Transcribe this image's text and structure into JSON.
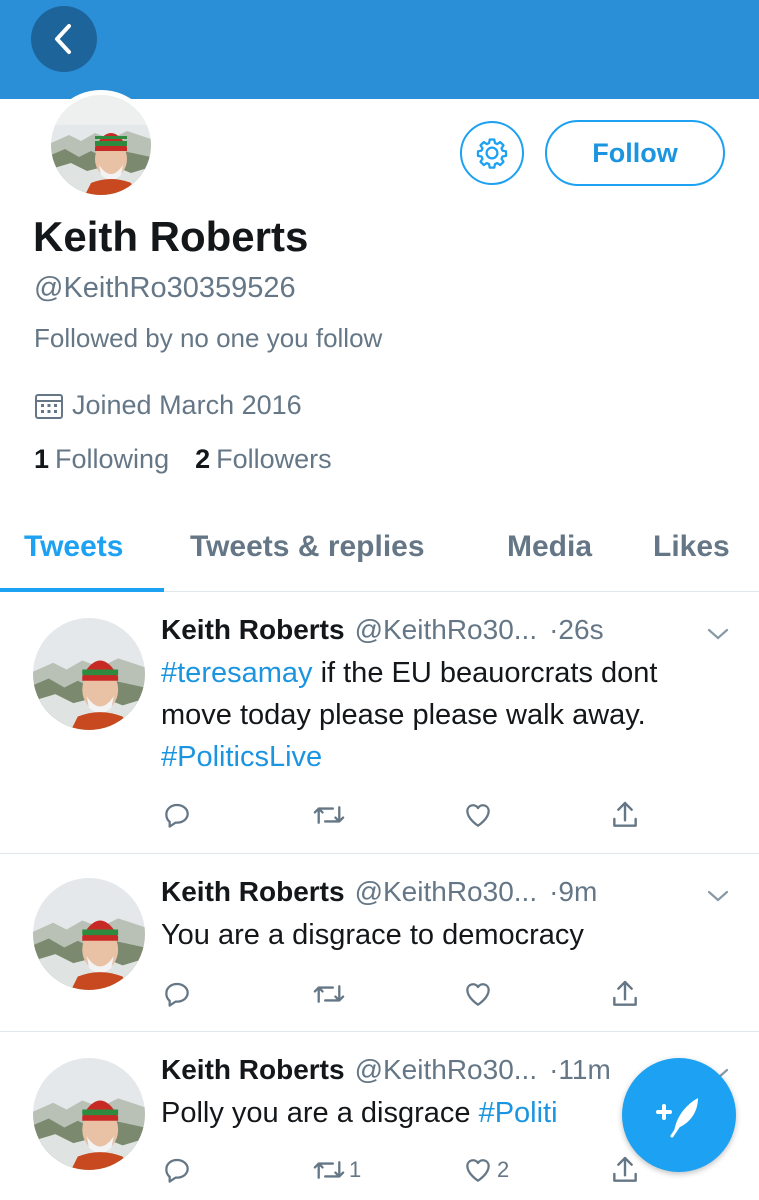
{
  "profile": {
    "name": "Keith Roberts",
    "handle": "@KeithRo30359526",
    "followed_by": "Followed by no one you follow",
    "joined": "Joined March 2016",
    "following_count": "1",
    "following_label": "Following",
    "followers_count": "2",
    "followers_label": "Followers",
    "follow_label": "Follow"
  },
  "tabs": [
    {
      "label": "Tweets",
      "active": true
    },
    {
      "label": "Tweets & replies"
    },
    {
      "label": "Media"
    },
    {
      "label": "Likes"
    }
  ],
  "tweets": [
    {
      "name": "Keith Roberts",
      "handle": "@KeithRo30...",
      "time": "·26s",
      "text_parts": [
        "#teresamay",
        " if the EU beauorcrats dont move today please please walk away. ",
        "#PoliticsLive"
      ]
    },
    {
      "name": "Keith Roberts",
      "handle": "@KeithRo30...",
      "time": "·9m",
      "text": "You are a disgrace to democracy"
    },
    {
      "name": "Keith Roberts",
      "handle": "@KeithRo30...",
      "time": "·11m",
      "text_parts": [
        "Polly you are a disgrace ",
        "#Politi"
      ],
      "retweets": "1",
      "likes": "2"
    }
  ],
  "colors": {
    "header": "#2b8fd8",
    "accent": "#1da1f2",
    "secondary_text": "#657786"
  },
  "icons": [
    "back-chevron-icon",
    "gear-icon",
    "calendar-icon",
    "reply-icon",
    "retweet-icon",
    "like-icon",
    "share-icon",
    "chevron-down-icon",
    "compose-icon"
  ]
}
